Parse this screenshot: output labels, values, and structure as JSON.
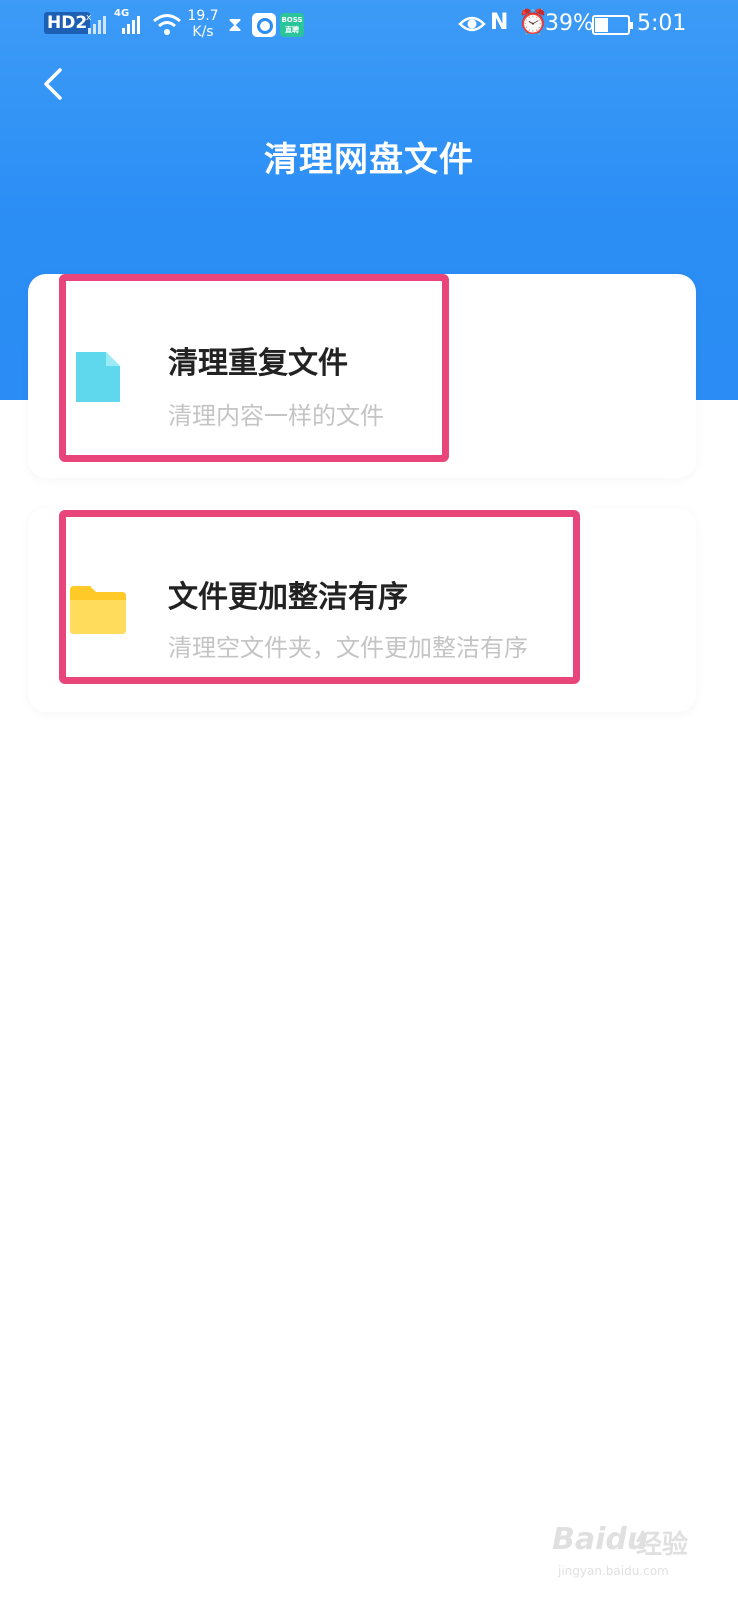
{
  "status_bar": {
    "hd_badge": "HD2",
    "network": "4G",
    "speed_value": "19.7",
    "speed_unit": "K/s",
    "app_badge_top": "BOSS",
    "app_badge_bottom": "直聘",
    "battery_percent": "39%",
    "time": "5:01"
  },
  "header": {
    "title": "清理网盘文件",
    "background_color": "#2b8ef5"
  },
  "cards": [
    {
      "title": "清理重复文件",
      "subtitle": "清理内容一样的文件",
      "icon": "file-icon",
      "icon_color": "#5fd8ee"
    },
    {
      "title": "文件更加整洁有序",
      "subtitle": "清理空文件夹，文件更加整洁有序",
      "icon": "folder-icon",
      "icon_color": "#ffd23f"
    }
  ],
  "highlight_color": "#e8457b",
  "watermark": {
    "logo": "Baidu",
    "label": "经验",
    "url": "jingyan.baidu.com"
  }
}
